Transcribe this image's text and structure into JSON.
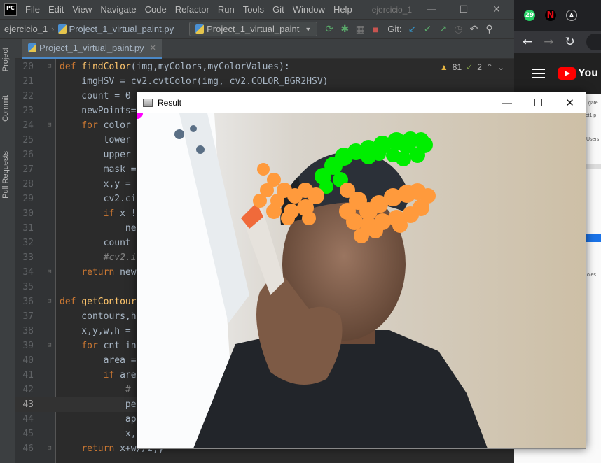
{
  "ide": {
    "logo_text": "PC",
    "menu": [
      "File",
      "Edit",
      "View",
      "Navigate",
      "Code",
      "Refactor",
      "Run",
      "Tools",
      "Git",
      "Window",
      "Help"
    ],
    "project_title": "ejercicio_1",
    "nav": {
      "project": "ejercicio_1",
      "file": "Project_1_virtual_paint.py",
      "run_config": "Project_1_virtual_paint",
      "git_label": "Git:"
    },
    "side_tabs": [
      "Project",
      "Commit",
      "Pull Requests"
    ],
    "tab": {
      "label": "Project_1_virtual_paint.py"
    },
    "inspections": {
      "warnings": "81",
      "weak": "2"
    },
    "current_line": 43,
    "lines": [
      {
        "n": "20",
        "text": "def findColor(img,myColors,myColorValues):"
      },
      {
        "n": "21",
        "text": "    imgHSV = cv2.cvtColor(img, cv2.COLOR_BGR2HSV)"
      },
      {
        "n": "22",
        "text": "    count = 0"
      },
      {
        "n": "23",
        "text": "    newPoints="
      },
      {
        "n": "24",
        "text": "    for color"
      },
      {
        "n": "25",
        "text": "        lower"
      },
      {
        "n": "26",
        "text": "        upper"
      },
      {
        "n": "27",
        "text": "        mask ="
      },
      {
        "n": "28",
        "text": "        x,y ="
      },
      {
        "n": "29",
        "text": "        cv2.ci"
      },
      {
        "n": "30",
        "text": "        if x !"
      },
      {
        "n": "31",
        "text": "            ne"
      },
      {
        "n": "32",
        "text": "        count"
      },
      {
        "n": "33",
        "text": "        #cv2.i"
      },
      {
        "n": "34",
        "text": "    return new"
      },
      {
        "n": "35",
        "text": ""
      },
      {
        "n": "36",
        "text": "def getContour"
      },
      {
        "n": "37",
        "text": "    contours,h"
      },
      {
        "n": "38",
        "text": "    x,y,w,h ="
      },
      {
        "n": "39",
        "text": "    for cnt in"
      },
      {
        "n": "40",
        "text": "        area ="
      },
      {
        "n": "41",
        "text": "        if are"
      },
      {
        "n": "42",
        "text": "            #"
      },
      {
        "n": "43",
        "text": "            pe"
      },
      {
        "n": "44",
        "text": "            ap"
      },
      {
        "n": "45",
        "text": "            x,"
      },
      {
        "n": "46",
        "text": "    return x+w//2,y"
      }
    ]
  },
  "result_window": {
    "title": "Result"
  },
  "browser": {
    "tab_badge": "29",
    "peek_texts": [
      "gate",
      "ct1.p",
      "Users",
      "oles"
    ]
  },
  "colors": {
    "accent": "#4a88c7",
    "stroke_green": "#00ee00",
    "stroke_orange": "#ff9a3c",
    "stroke_magenta": "#ff00ff"
  }
}
